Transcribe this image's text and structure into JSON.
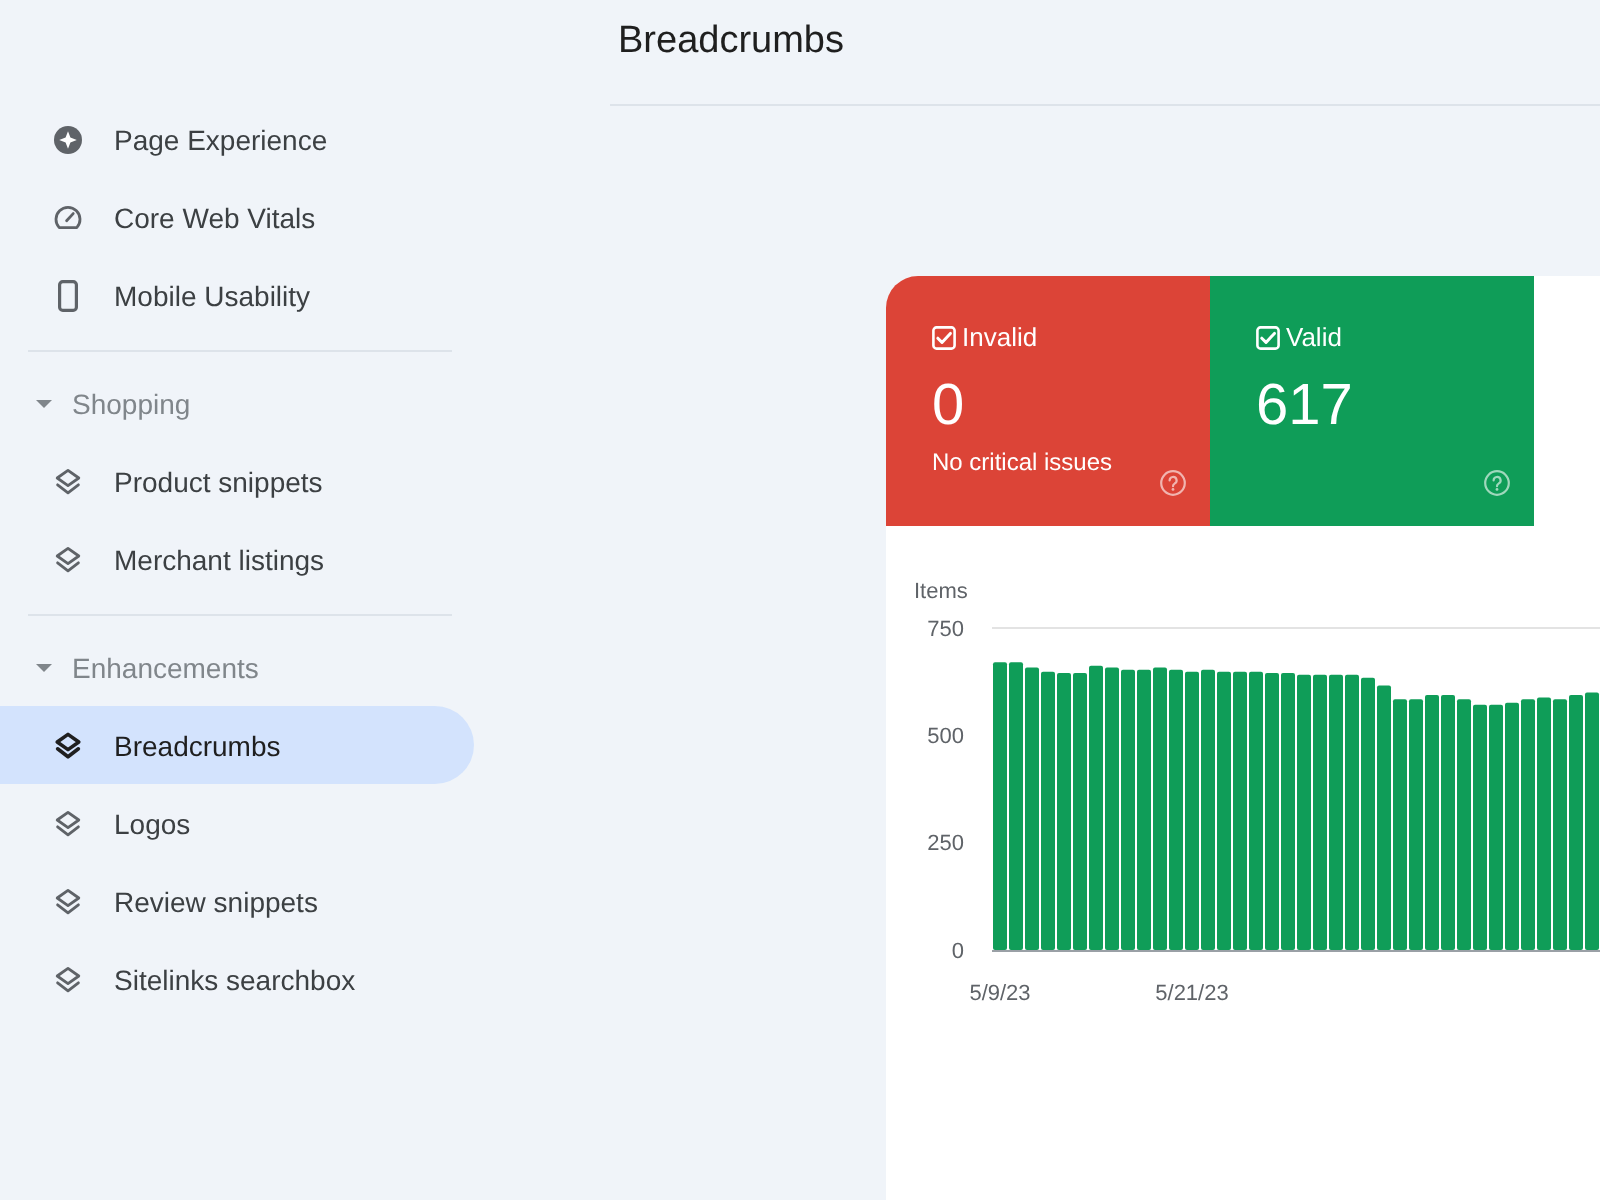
{
  "header": {
    "title": "Breadcrumbs"
  },
  "sidebar": {
    "sections": [
      {
        "items": [
          {
            "label": "Page Experience",
            "kind": "experience",
            "selected": false
          },
          {
            "label": "Core Web Vitals",
            "kind": "vitals",
            "selected": false
          },
          {
            "label": "Mobile Usability",
            "kind": "mobile",
            "selected": false
          }
        ]
      },
      {
        "title": "Shopping",
        "expanded": true,
        "items": [
          {
            "label": "Product snippets",
            "kind": "layers",
            "selected": false
          },
          {
            "label": "Merchant listings",
            "kind": "layers",
            "selected": false
          }
        ]
      },
      {
        "title": "Enhancements",
        "expanded": true,
        "items": [
          {
            "label": "Breadcrumbs",
            "kind": "layers",
            "selected": true
          },
          {
            "label": "Logos",
            "kind": "layers",
            "selected": false
          },
          {
            "label": "Review snippets",
            "kind": "layers",
            "selected": false
          },
          {
            "label": "Sitelinks searchbox",
            "kind": "layers",
            "selected": false
          }
        ]
      }
    ]
  },
  "summary": {
    "cards": [
      {
        "label": "Invalid",
        "checked": true,
        "count": "0",
        "note": "No critical issues",
        "color": "#dc4437"
      },
      {
        "label": "Valid",
        "checked": true,
        "count": "617",
        "color": "#0f9d58"
      }
    ]
  },
  "chart": {
    "chart_data": {
      "type": "bar",
      "ylabel": "Items",
      "categories": [
        "5/9/23",
        null,
        null,
        null,
        null,
        null,
        null,
        null,
        null,
        null,
        null,
        null,
        "5/21/23",
        null,
        null,
        null,
        null,
        null,
        null,
        null,
        null,
        null,
        null,
        null,
        null,
        null,
        null,
        null,
        null,
        null,
        null,
        null,
        null,
        null,
        null,
        null,
        null,
        null
      ],
      "values": [
        670,
        670,
        658,
        648,
        645,
        645,
        662,
        658,
        653,
        653,
        658,
        653,
        648,
        653,
        648,
        648,
        648,
        645,
        645,
        641,
        641,
        641,
        641,
        634,
        616,
        584,
        584,
        594,
        594,
        584,
        571,
        571,
        576,
        584,
        588,
        584,
        594,
        600
      ],
      "ylim": [
        0,
        750
      ],
      "yticks": [
        0,
        250,
        500,
        750
      ]
    }
  }
}
